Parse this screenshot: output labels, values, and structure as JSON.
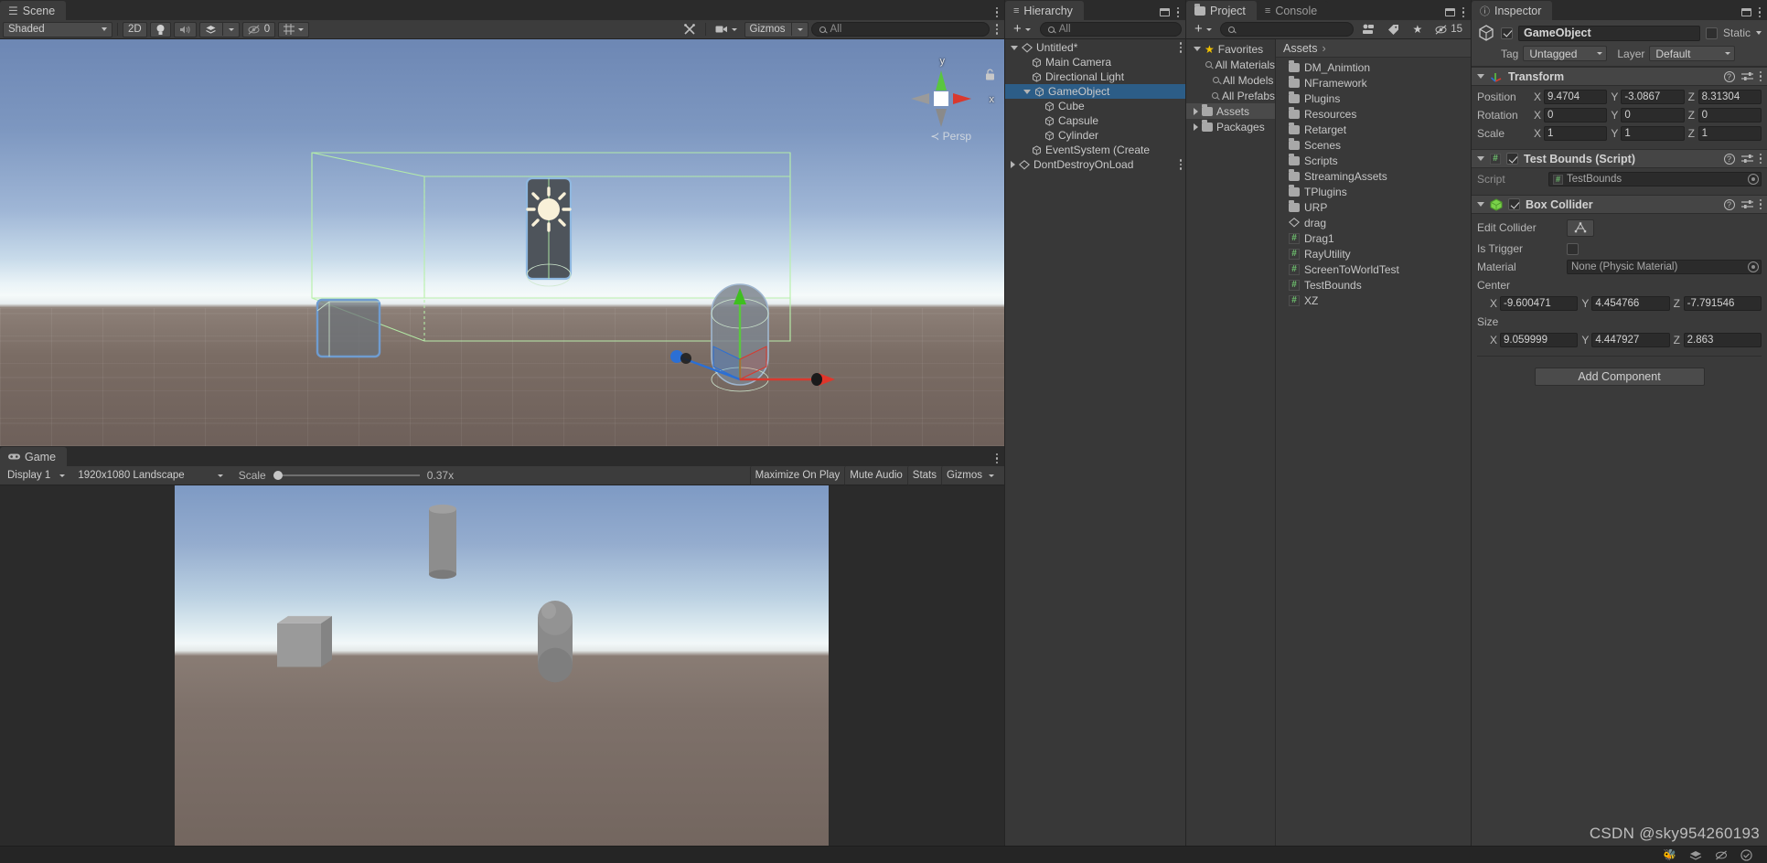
{
  "scene_panel": {
    "tab_label": "Scene",
    "tab_icon": "grid-icon",
    "toolbar": {
      "shading_mode": "Shaded",
      "two_d_label": "2D",
      "lighting_icon": "lightbulb-icon",
      "audio_icon": "speaker-icon",
      "fx_icon": "effects-icon",
      "hidden_objects_count": "0",
      "grid_icon": "grid-toggle-icon",
      "tools_icon": "tools-icon",
      "camera_icon": "camera-icon",
      "gizmos_label": "Gizmos",
      "search_placeholder": "All"
    },
    "gizmo": {
      "y_label": "y",
      "x_label": "x",
      "perspective_label": "Persp",
      "lock_icon": "lock-icon"
    }
  },
  "game_panel": {
    "tab_label": "Game",
    "tab_icon": "gamepad-icon",
    "toolbar": {
      "display": "Display 1",
      "resolution": "1920x1080 Landscape",
      "scale_label": "Scale",
      "scale_value": "0.37x",
      "maximize_on_play": "Maximize On Play",
      "mute_audio": "Mute Audio",
      "stats": "Stats",
      "gizmos": "Gizmos"
    }
  },
  "hierarchy": {
    "tab_label": "Hierarchy",
    "tab_icon": "list-icon",
    "add_label": "+",
    "search_placeholder": "All",
    "items": [
      {
        "label": "Untitled*",
        "indent": 0,
        "icon": "scene-icon",
        "expanded": true,
        "selected": false,
        "has_kebab": true
      },
      {
        "label": "Main Camera",
        "indent": 1,
        "icon": "gameobject-icon",
        "expanded": null,
        "selected": false,
        "has_kebab": false
      },
      {
        "label": "Directional Light",
        "indent": 1,
        "icon": "gameobject-icon",
        "expanded": null,
        "selected": false,
        "has_kebab": false
      },
      {
        "label": "GameObject",
        "indent": 1,
        "icon": "gameobject-icon",
        "expanded": true,
        "selected": true,
        "has_kebab": false
      },
      {
        "label": "Cube",
        "indent": 2,
        "icon": "gameobject-icon",
        "expanded": null,
        "selected": false,
        "has_kebab": false
      },
      {
        "label": "Capsule",
        "indent": 2,
        "icon": "gameobject-icon",
        "expanded": null,
        "selected": false,
        "has_kebab": false
      },
      {
        "label": "Cylinder",
        "indent": 2,
        "icon": "gameobject-icon",
        "expanded": null,
        "selected": false,
        "has_kebab": false
      },
      {
        "label": "EventSystem (Create",
        "indent": 1,
        "icon": "gameobject-icon",
        "expanded": null,
        "selected": false,
        "has_kebab": false
      },
      {
        "label": "DontDestroyOnLoad",
        "indent": 0,
        "icon": "scene-icon",
        "expanded": false,
        "selected": false,
        "has_kebab": true
      }
    ]
  },
  "project": {
    "tab_label": "Project",
    "tab_icon": "folder-icon",
    "console_tab_label": "Console",
    "console_tab_icon": "console-icon",
    "toolbar": {
      "add_label": "+",
      "search_placeholder": "",
      "packages_icon": "package-icon",
      "label_icon": "tag-icon",
      "favorite_icon": "star-icon",
      "hidden_count": "15"
    },
    "tree": [
      {
        "label": "Favorites",
        "indent": 0,
        "icon": "star-icon",
        "expanded": true,
        "highlight": false
      },
      {
        "label": "All Materials",
        "indent": 1,
        "icon": "search-icon",
        "expanded": null,
        "highlight": false
      },
      {
        "label": "All Models",
        "indent": 1,
        "icon": "search-icon",
        "expanded": null,
        "highlight": false
      },
      {
        "label": "All Prefabs",
        "indent": 1,
        "icon": "search-icon",
        "expanded": null,
        "highlight": false
      },
      {
        "label": "Assets",
        "indent": 0,
        "icon": "folder-icon",
        "expanded": false,
        "highlight": true
      },
      {
        "label": "Packages",
        "indent": 0,
        "icon": "folder-icon",
        "expanded": false,
        "highlight": false
      }
    ],
    "breadcrumb": "Assets",
    "assets": [
      {
        "label": "DM_Animtion",
        "icon": "folder-icon"
      },
      {
        "label": "NFramework",
        "icon": "folder-icon"
      },
      {
        "label": "Plugins",
        "icon": "folder-icon"
      },
      {
        "label": "Resources",
        "icon": "folder-icon"
      },
      {
        "label": "Retarget",
        "icon": "folder-icon"
      },
      {
        "label": "Scenes",
        "icon": "folder-icon"
      },
      {
        "label": "Scripts",
        "icon": "folder-icon"
      },
      {
        "label": "StreamingAssets",
        "icon": "folder-icon"
      },
      {
        "label": "TPlugins",
        "icon": "folder-icon"
      },
      {
        "label": "URP",
        "icon": "folder-icon"
      },
      {
        "label": "drag",
        "icon": "unity-scene-icon"
      },
      {
        "label": "Drag1",
        "icon": "csharp-icon"
      },
      {
        "label": "RayUtility",
        "icon": "csharp-icon"
      },
      {
        "label": "ScreenToWorldTest",
        "icon": "csharp-icon"
      },
      {
        "label": "TestBounds",
        "icon": "csharp-icon"
      },
      {
        "label": "XZ",
        "icon": "csharp-icon"
      }
    ]
  },
  "inspector": {
    "tab_label": "Inspector",
    "tab_icon": "info-icon",
    "gameobject": {
      "enabled": true,
      "name": "GameObject",
      "static_label": "Static",
      "tag_label": "Tag",
      "tag_value": "Untagged",
      "layer_label": "Layer",
      "layer_value": "Default"
    },
    "transform": {
      "title": "Transform",
      "icon": "transform-axis-icon",
      "rows": [
        {
          "label": "Position",
          "x": "9.4704",
          "y": "-3.0867",
          "z": "8.31304"
        },
        {
          "label": "Rotation",
          "x": "0",
          "y": "0",
          "z": "0"
        },
        {
          "label": "Scale",
          "x": "1",
          "y": "1",
          "z": "1"
        }
      ]
    },
    "test_bounds": {
      "title": "Test Bounds (Script)",
      "icon": "csharp-icon",
      "enabled": true,
      "script_label": "Script",
      "script_value": "TestBounds"
    },
    "box_collider": {
      "title": "Box Collider",
      "icon": "box-collider-icon",
      "enabled": true,
      "edit_collider_label": "Edit Collider",
      "edit_collider_icon": "edit-collider-icon",
      "is_trigger_label": "Is Trigger",
      "is_trigger_value": false,
      "material_label": "Material",
      "material_value": "None (Physic Material)",
      "center_label": "Center",
      "center": {
        "x": "-9.600471",
        "y": "4.454766",
        "z": "-7.791546"
      },
      "size_label": "Size",
      "size": {
        "x": "9.059999",
        "y": "4.447927",
        "z": "2.863"
      }
    },
    "add_component_label": "Add Component"
  },
  "watermark": "CSDN @sky954260193",
  "colors": {
    "selection_blue": "#2c5d87",
    "panel_bg": "#383838",
    "toolbar_bg": "#3c3c3c",
    "accent_green": "#6ec06e",
    "star_yellow": "#f2c200",
    "gizmo_x": "#d9392e",
    "gizmo_y": "#5ac63f",
    "gizmo_z": "#2b6fd4"
  }
}
